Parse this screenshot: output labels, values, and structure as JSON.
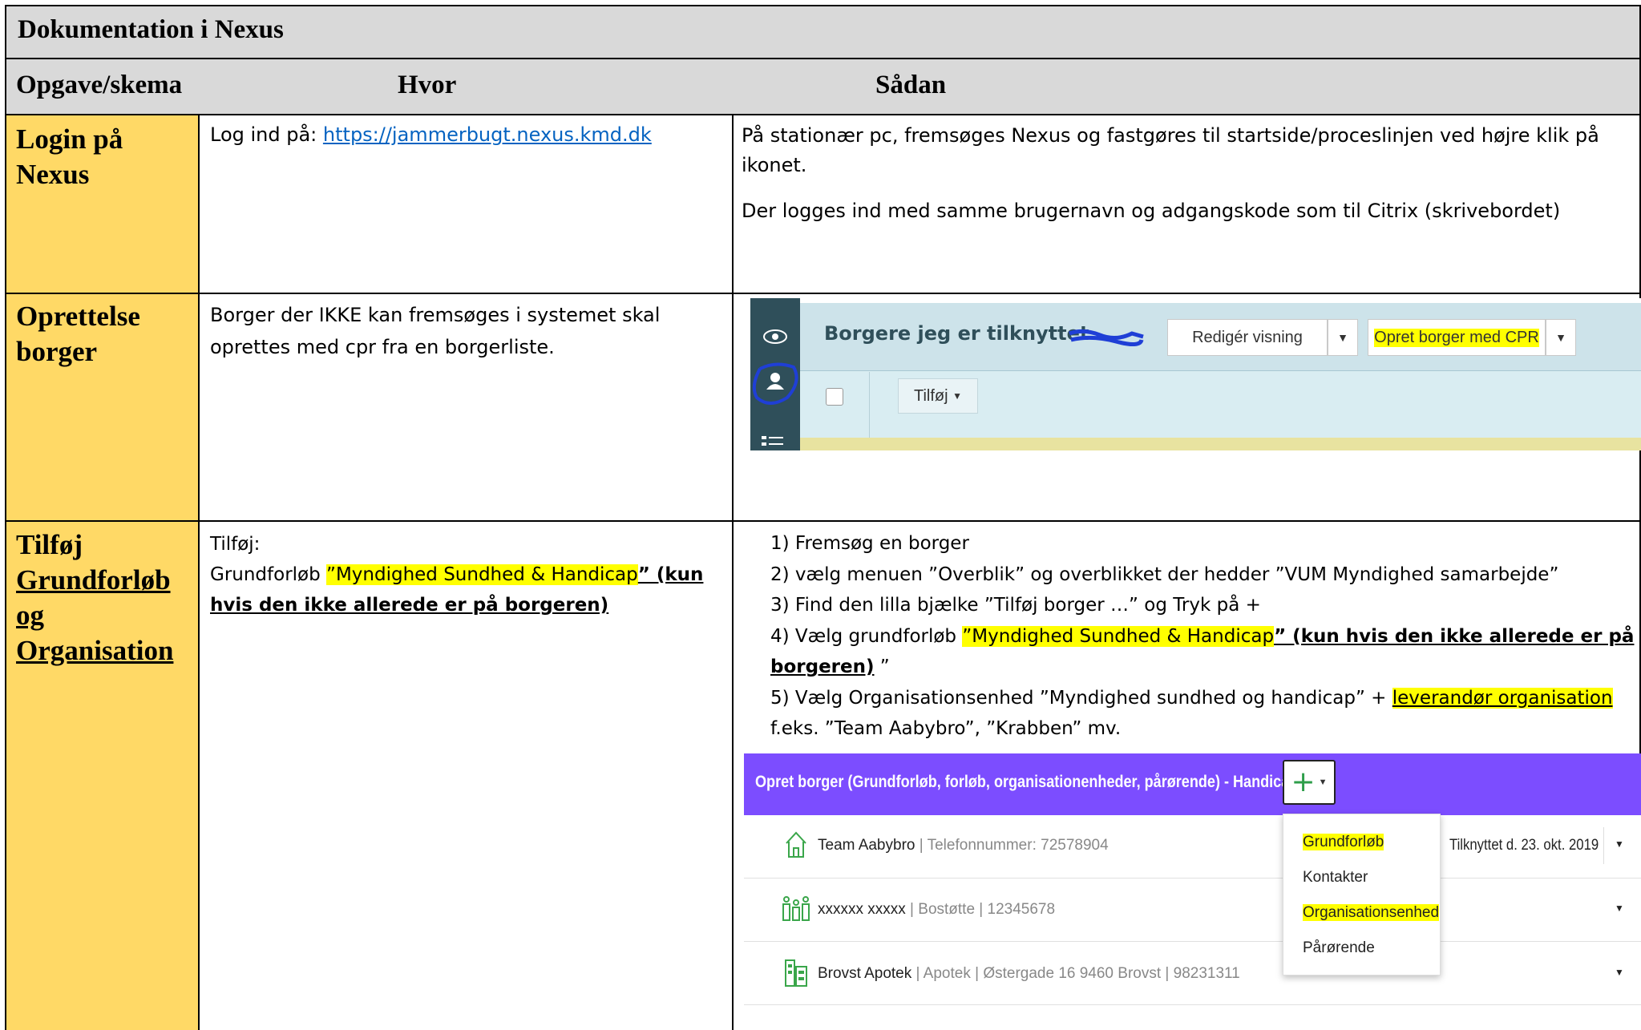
{
  "title": "Dokumentation i Nexus",
  "headers": {
    "col1": "Opgave/skema",
    "col2": "Hvor",
    "col3": "Sådan"
  },
  "rows": {
    "login": {
      "task": "Login på Nexus",
      "where_prefix": "Log ind på: ",
      "where_link": "https://jammerbugt.nexus.kmd.dk",
      "how_p1": "På stationær pc, fremsøges Nexus og fastgøres til startside/proceslinjen ved højre klik på ikonet.",
      "how_p2": "Der logges ind med samme brugernavn og adgangskode som til Citrix (skrivebordet)"
    },
    "oprettelse": {
      "task": "Oprettelse borger",
      "where": "Borger der IKKE kan fremsøges i systemet skal oprettes med cpr fra en borgerliste."
    },
    "tilfoj": {
      "task_line1": "Tilføj",
      "task_line2": "Grundforløb",
      "task_line3": "og",
      "task_line4": "Organisation",
      "where_line1": "Tilføj:",
      "where_prefix": "Grundforløb ",
      "where_highlight": "”Myndighed Sundhed & Handicap",
      "where_bold": "” (kun hvis den ikke allerede er på borgeren)",
      "steps": {
        "s1": "1) Fremsøg en borger",
        "s2": "2) vælg menuen ”Overblik” og overblikket der hedder ”VUM Myndighed samarbejde”",
        "s3": "3) Find den lilla bjælke ”Tilføj borger …” og Tryk på +",
        "s4_prefix": "4) Vælg grundforløb ",
        "s4_highlight": "”Myndighed Sundhed & Handicap",
        "s4_bold": "” (kun hvis den ikke allerede er på borgeren)",
        "s4_suffix": " ”",
        "s5_prefix": "5) Vælg Organisationsenhed ”Myndighed sundhed og handicap” + ",
        "s5_highlight": "leverandør organisation",
        "s5_line2": "f.eks. ”Team Aabybro”, ”Krabben” mv."
      }
    }
  },
  "screenshot1": {
    "title": "Borgere jeg er tilknyttet",
    "edit_view": "Redigér visning",
    "create_cpr": "Opret borger med CPR",
    "add": "Tilføj"
  },
  "screenshot2": {
    "header": "Opret borger (Grundforløb, forløb, organisationenheder, pårørende) - Handicap",
    "row1_name": "Team Aabybro",
    "row1_detail": " | Telefonnummer: 72578904",
    "row1_date": "Tilknyttet d. 23. okt. 2019",
    "row2_name": "xxxxxx xxxxx",
    "row2_detail": " | Bostøtte | 12345678",
    "row3_name": "Brovst Apotek",
    "row3_detail": " | Apotek | Østergade 16 9460 Brovst | 98231311",
    "menu": {
      "item1": "Grundforløb",
      "item2": "Kontakter",
      "item3": "Organisationsenhed",
      "item4": "Pårørende"
    }
  },
  "colors": {
    "header_grey": "#d9d9d9",
    "task_yellow": "#ffd966",
    "highlight": "#ffff00",
    "purple": "#7c4dff"
  }
}
